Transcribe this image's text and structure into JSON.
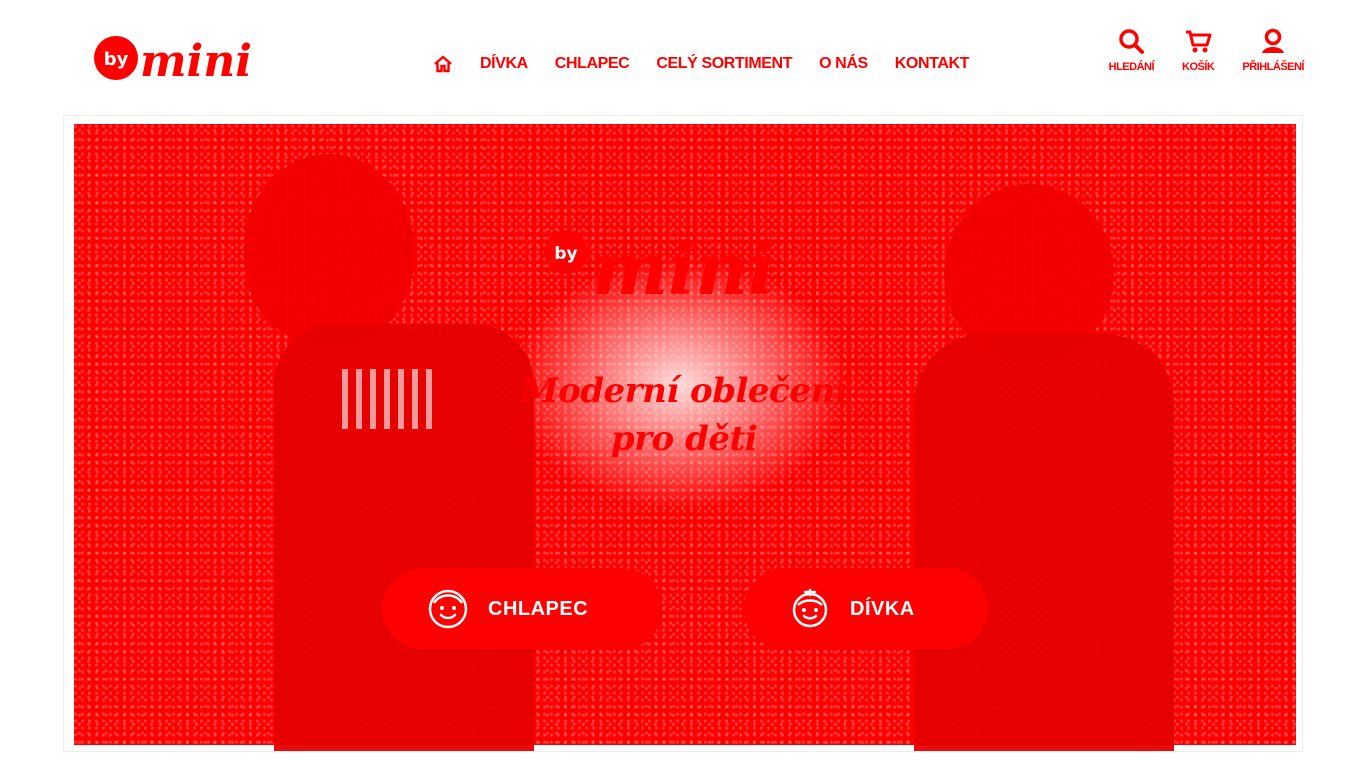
{
  "brand": {
    "logo_by": "by",
    "logo_word": "mini",
    "accent_color": "#ff0000",
    "background_color": "#ffffff"
  },
  "nav": {
    "home_icon": "home-icon",
    "items": [
      {
        "label": "DÍVKA"
      },
      {
        "label": "CHLAPEC"
      },
      {
        "label": "CELÝ SORTIMENT"
      },
      {
        "label": "O NÁS"
      },
      {
        "label": "KONTAKT"
      }
    ]
  },
  "tools": {
    "search": {
      "label": "HLEDÁNÍ",
      "icon": "search-icon"
    },
    "cart": {
      "label": "KOŠÍK",
      "icon": "cart-icon"
    },
    "login": {
      "label": "PŘIHLÁŠENÍ",
      "icon": "user-icon"
    }
  },
  "hero": {
    "logo_by": "by",
    "logo_word": "mini",
    "title_line1": "Moderní oblečení",
    "title_line2": "pro děti",
    "buttons": {
      "boy": {
        "label": "CHLAPEC",
        "icon": "boy-face-icon"
      },
      "girl": {
        "label": "DÍVKA",
        "icon": "girl-face-icon"
      }
    }
  }
}
